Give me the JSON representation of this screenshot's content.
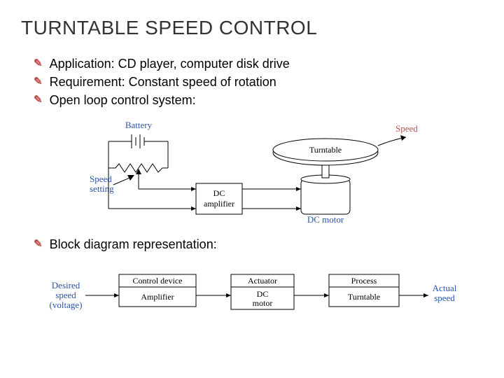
{
  "title": "TURNTABLE SPEED CONTROL",
  "bullets": {
    "b0": "Application: CD player, computer disk drive",
    "b1": "Requirement: Constant speed of rotation",
    "b2": "Open loop control system:",
    "b3": "Block diagram representation:"
  },
  "schematic": {
    "battery": "Battery",
    "speed_setting": "Speed",
    "speed_setting2": "setting",
    "dc_amp1": "DC",
    "dc_amp2": "amplifier",
    "dc_motor": "DC motor",
    "turntable": "Turntable",
    "speed": "Speed"
  },
  "block": {
    "input1": "Desired",
    "input2": "speed",
    "input3": "(voltage)",
    "ctrl_top": "Control device",
    "ctrl": "Amplifier",
    "act_top": "Actuator",
    "act1": "DC",
    "act2": "motor",
    "proc_top": "Process",
    "proc": "Turntable",
    "out1": "Actual",
    "out2": "speed"
  }
}
